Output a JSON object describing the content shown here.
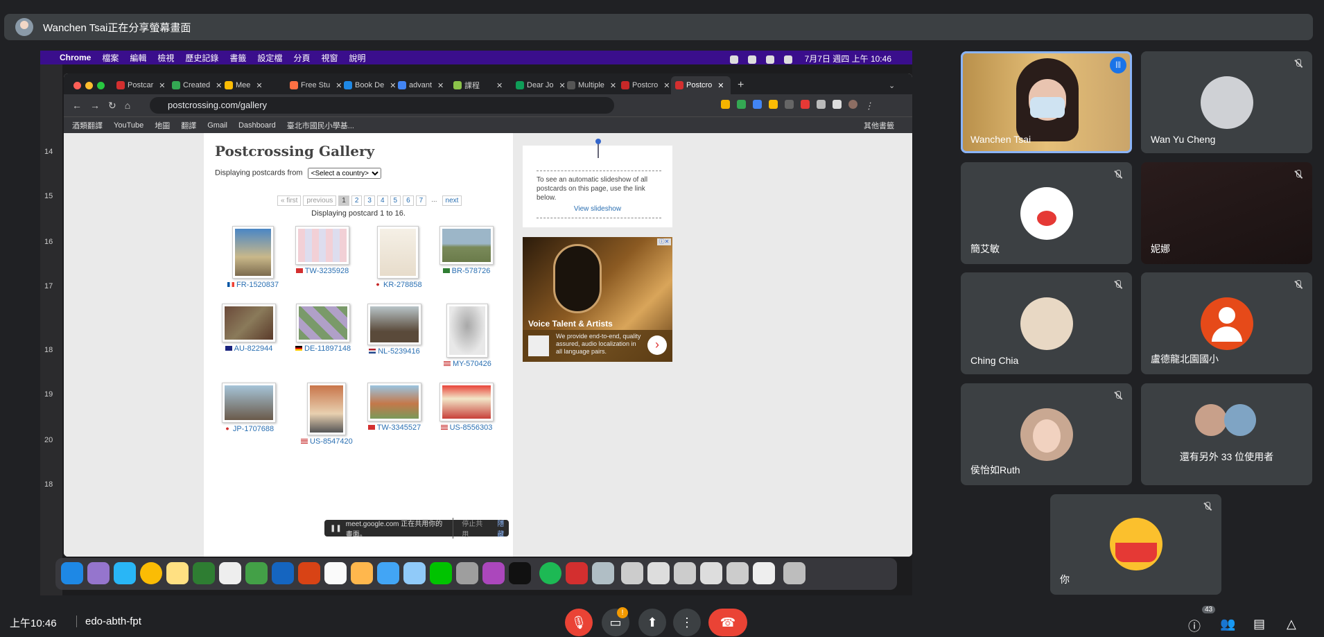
{
  "meet_header": {
    "presenter_text": "Wanchen Tsai正在分享螢幕畫面"
  },
  "mac_menubar": {
    "items": [
      "Chrome",
      "檔案",
      "編輯",
      "檢視",
      "歷史記錄",
      "書籤",
      "設定檔",
      "分頁",
      "視窗",
      "說明"
    ],
    "datetime": "7月7日 週四 上午 10:46"
  },
  "left_app": {
    "row_numbers": [
      "14",
      "15",
      "16",
      "17",
      "18",
      "19",
      "20",
      "18"
    ]
  },
  "browser": {
    "tabs": [
      "Postcar",
      "Created",
      "Mee",
      "Free Stu",
      "Book De",
      "advant",
      "課程",
      "Dear Jo",
      "Multiple",
      "Postcro",
      "Postcro"
    ],
    "new_tab": "+",
    "url": "postcrossing.com/gallery",
    "bookmarks": [
      "酒類翻譯",
      "YouTube",
      "地圖",
      "翻譯",
      "Gmail",
      "Dashboard",
      "臺北市國民小學基..."
    ],
    "other_bookmarks": "其他書籤"
  },
  "gallery": {
    "title": "Postcrossing Gallery",
    "filter_label": "Displaying postcards from",
    "filter_value": "<Select a country>",
    "pager": {
      "first": "« first",
      "previous": "previous",
      "pages": [
        "1",
        "2",
        "3",
        "4",
        "5",
        "6",
        "7"
      ],
      "ellipsis": "...",
      "next": "next"
    },
    "count_text": "Displaying postcard 1 to 16.",
    "postcards": [
      {
        "id": "FR-1520837"
      },
      {
        "id": "TW-3235928"
      },
      {
        "id": "KR-278858"
      },
      {
        "id": "BR-578726"
      },
      {
        "id": "AU-822944"
      },
      {
        "id": "DE-11897148"
      },
      {
        "id": "NL-5239416"
      },
      {
        "id": "MY-570426"
      },
      {
        "id": "JP-1707688"
      },
      {
        "id": "US-8547420"
      },
      {
        "id": "TW-3345527"
      },
      {
        "id": "US-8556303"
      }
    ],
    "slideshow_text": "To see an automatic slideshow of all postcards on this page, use the link below.",
    "slideshow_link": "View slideshow",
    "ad": {
      "title": "Voice Talent & Artists",
      "desc": "We provide end-to-end, quality assured, audio localization in all language pairs."
    }
  },
  "share_banner": {
    "text": "meet.google.com 正在共用你的畫面。",
    "stop": "停止共用",
    "hide": "隱藏"
  },
  "participants": [
    {
      "name": "Wanchen Tsai"
    },
    {
      "name": "Wan Yu Cheng"
    },
    {
      "name": "簡艾敏"
    },
    {
      "name": "妮娜"
    },
    {
      "name": "Ching Chia"
    },
    {
      "name": "盧德龍北園國小"
    },
    {
      "name": "侯怡如Ruth"
    },
    {
      "name": "還有另外 33 位使用者"
    },
    {
      "name": "你"
    }
  ],
  "bottom": {
    "time": "上午10:46",
    "meeting_code": "edo-abth-fpt",
    "warning": "!",
    "people_count": "43"
  }
}
